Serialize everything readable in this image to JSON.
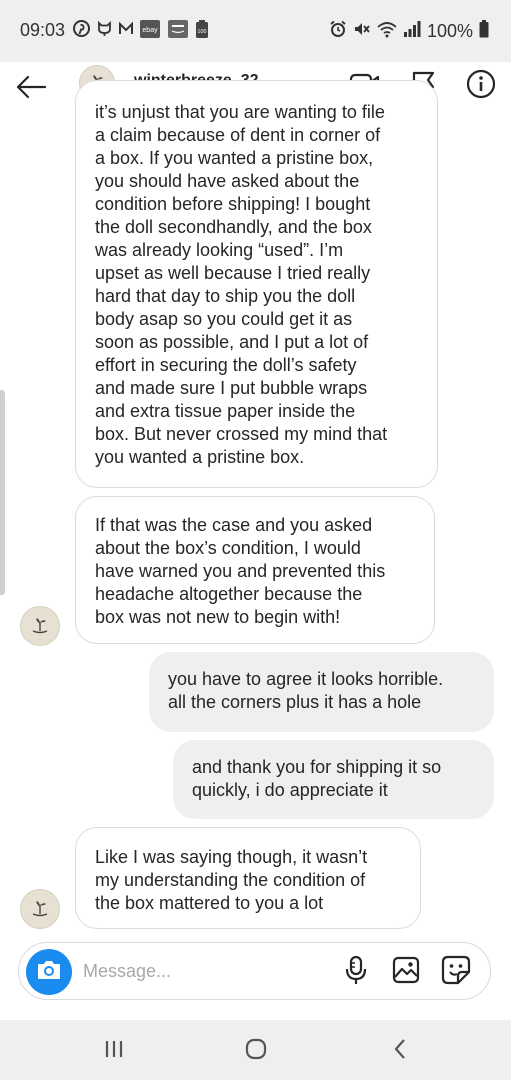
{
  "status_bar": {
    "time": "09:03",
    "battery": "100%",
    "left_icons": [
      "pinterest-icon",
      "github-icon",
      "gmail-icon",
      "ebay-icon",
      "amazon-icon",
      "notification-100-icon"
    ],
    "right_icons": [
      "alarm-icon",
      "mute-icon",
      "wifi-icon",
      "signal-icon",
      "battery-icon"
    ]
  },
  "header": {
    "username": "winterbreeze_32",
    "icons": [
      "back-arrow-icon",
      "avatar",
      "video-call-icon",
      "flag-icon",
      "info-icon"
    ]
  },
  "messages": [
    {
      "from": "other",
      "lines": [
        "it’s unjust that you are wanting to file",
        "a claim because of dent in corner of",
        "a box. If you wanted a pristine box,",
        "you should have asked about the",
        "condition before shipping! I bought",
        "the doll secondhandly, and the box",
        "was already looking “used”. I’m",
        "upset as well because I tried really",
        "hard that day to ship you the doll",
        "body asap so you could get it as",
        "soon as possible, and I put a lot of",
        "effort in securing the doll’s safety",
        "and made sure I put bubble wraps",
        "and extra tissue paper inside the",
        "box. But never crossed my mind that",
        "you wanted a pristine box."
      ]
    },
    {
      "from": "other",
      "lines": [
        "If that was the case and you asked",
        "about the box’s condition, I would",
        "have warned you and prevented this",
        "headache altogether because the",
        "box was not new to begin with!"
      ]
    },
    {
      "from": "me",
      "lines": [
        "you have to agree it looks horrible.",
        "all the corners plus it has a hole"
      ]
    },
    {
      "from": "me",
      "lines": [
        "and thank you for shipping it so",
        "quickly, i do appreciate it"
      ]
    },
    {
      "from": "other",
      "lines": [
        "Like I was saying though, it wasn’t",
        "my understanding the condition of",
        "the box mattered to you a lot"
      ]
    }
  ],
  "composer": {
    "placeholder": "Message...",
    "icons": [
      "camera-icon",
      "microphone-icon",
      "gallery-icon",
      "sticker-icon"
    ]
  },
  "nav_bar": {
    "icons": [
      "recent-apps-icon",
      "home-icon",
      "back-icon"
    ]
  },
  "colors": {
    "accent_blue": "#1a8cf0",
    "sent_bubble": "#efefef",
    "received_border": "#dbdbdb",
    "bars": "#efefef"
  }
}
